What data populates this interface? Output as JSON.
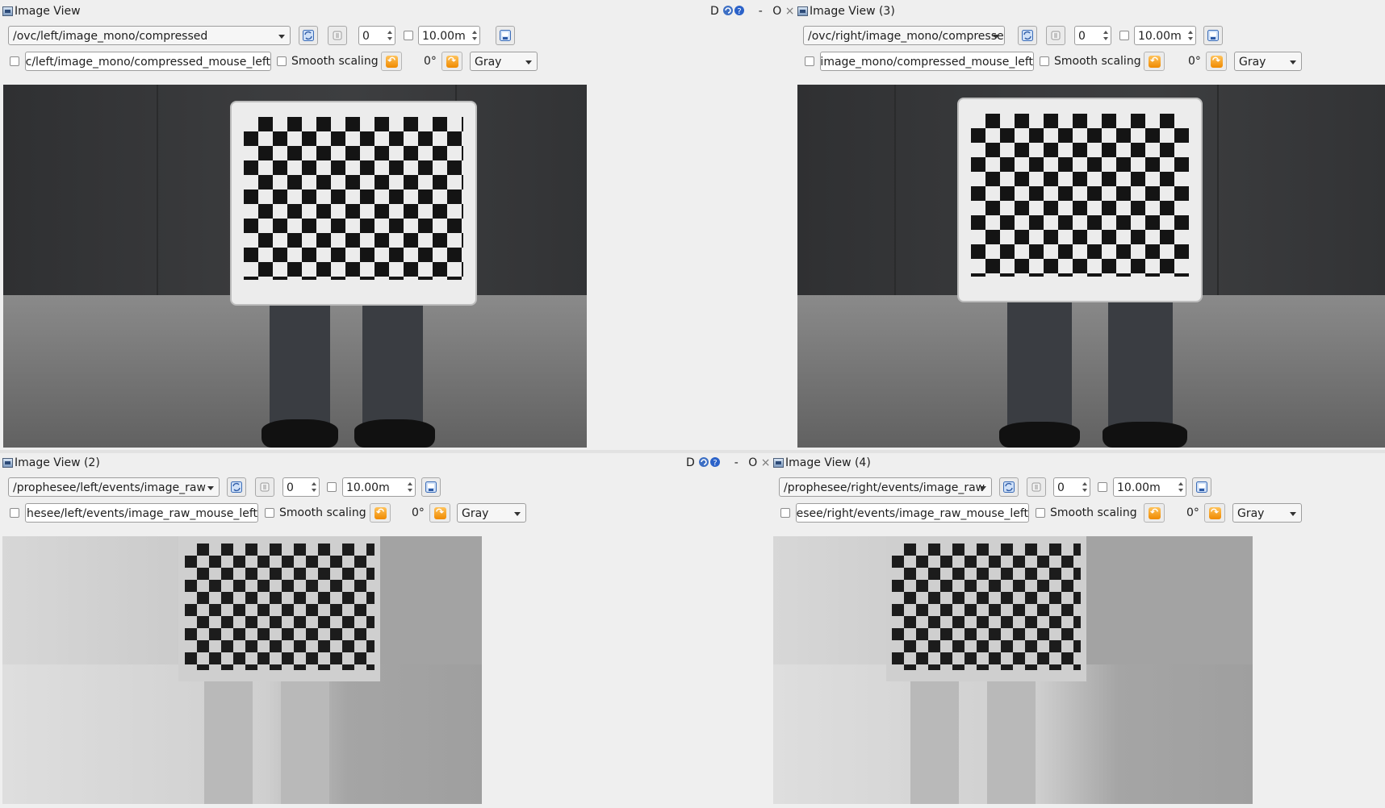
{
  "window_controls": {
    "dock": "D",
    "float": "O",
    "minimize": "-",
    "close": "×"
  },
  "views": [
    {
      "id": "p1",
      "title": "Image View",
      "topic": "/ovc/left/image_mono/compressed",
      "num_gridlines": "0",
      "max_range": "10.00m",
      "mouse_topic": "/ovc/left/image_mono/compressed_mouse_left",
      "smooth_label": "Smooth scaling",
      "rotation": "0°",
      "colormap": "Gray"
    },
    {
      "id": "p3",
      "title": "Image View (3)",
      "topic": "/ovc/right/image_mono/compressed",
      "num_gridlines": "0",
      "max_range": "10.00m",
      "mouse_topic": "/ovc/right/image_mono/compressed_mouse_left",
      "smooth_label": "Smooth scaling",
      "rotation": "0°",
      "colormap": "Gray"
    },
    {
      "id": "p2",
      "title": "Image View (2)",
      "topic": "/prophesee/left/events/image_raw",
      "num_gridlines": "0",
      "max_range": "10.00m",
      "mouse_topic": "/prophesee/left/events/image_raw_mouse_left",
      "smooth_label": "Smooth scaling",
      "rotation": "0°",
      "colormap": "Gray"
    },
    {
      "id": "p4",
      "title": "Image View (4)",
      "topic": "/prophesee/right/events/image_raw",
      "num_gridlines": "0",
      "max_range": "10.00m",
      "mouse_topic": "/prophesee/right/events/image_raw_mouse_left",
      "smooth_label": "Smooth scaling",
      "rotation": "0°",
      "colormap": "Gray"
    }
  ],
  "icons": {
    "refresh": "refresh-icon",
    "zoom": "zoom-icon",
    "save": "save-image-icon",
    "rotate_left": "rotate-left-icon",
    "rotate_right": "rotate-right-icon",
    "help": "help-icon",
    "reload": "reload-icon"
  }
}
